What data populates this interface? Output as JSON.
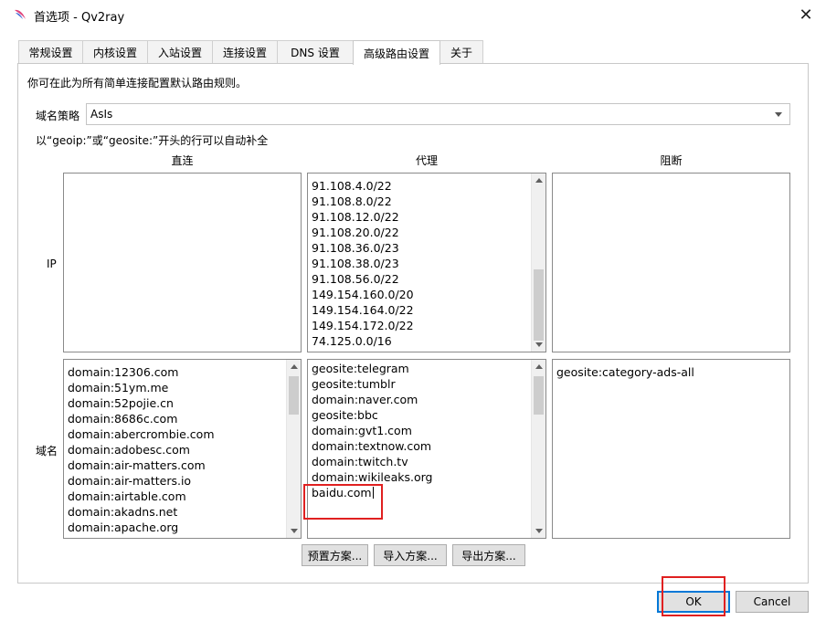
{
  "window": {
    "title": "首选项 - Qv2ray"
  },
  "tabs": [
    {
      "label": "常规设置"
    },
    {
      "label": "内核设置"
    },
    {
      "label": "入站设置"
    },
    {
      "label": "连接设置"
    },
    {
      "label": "DNS 设置"
    },
    {
      "label": "高级路由设置",
      "active": true
    },
    {
      "label": "关于"
    }
  ],
  "routing": {
    "description": "你可在此为所有简单连接配置默认路由规则。",
    "domain_strategy_label": "域名策略",
    "domain_strategy_value": "AsIs",
    "hint": "以“geoip:”或“geosite:”开头的行可以自动补全",
    "columns": {
      "direct": "直连",
      "proxy": "代理",
      "block": "阻断"
    },
    "rows": {
      "ip": "IP",
      "domain": "域名"
    },
    "ip_direct": [],
    "ip_proxy": [
      "91.108.4.0/22",
      "91.108.8.0/22",
      "91.108.12.0/22",
      "91.108.20.0/22",
      "91.108.36.0/23",
      "91.108.38.0/23",
      "91.108.56.0/22",
      "149.154.160.0/20",
      "149.154.164.0/22",
      "149.154.172.0/22",
      "74.125.0.0/16"
    ],
    "ip_block": [],
    "domain_direct": [
      "domain:12306.com",
      "domain:51ym.me",
      "domain:52pojie.cn",
      "domain:8686c.com",
      "domain:abercrombie.com",
      "domain:adobesc.com",
      "domain:air-matters.com",
      "domain:air-matters.io",
      "domain:airtable.com",
      "domain:akadns.net",
      "domain:apache.org"
    ],
    "domain_proxy": [
      "geosite:telegram",
      "geosite:tumblr",
      "domain:naver.com",
      "geosite:bbc",
      "domain:gvt1.com",
      "domain:textnow.com",
      "domain:twitch.tv",
      "domain:wikileaks.org",
      "baidu.com"
    ],
    "domain_block": [
      "geosite:category-ads-all"
    ],
    "buttons": {
      "preset": "预置方案...",
      "import": "导入方案...",
      "export": "导出方案..."
    }
  },
  "footer": {
    "ok": "OK",
    "cancel": "Cancel"
  },
  "colors": {
    "highlight_box": "#e02020",
    "focus_border": "#0078d7"
  }
}
